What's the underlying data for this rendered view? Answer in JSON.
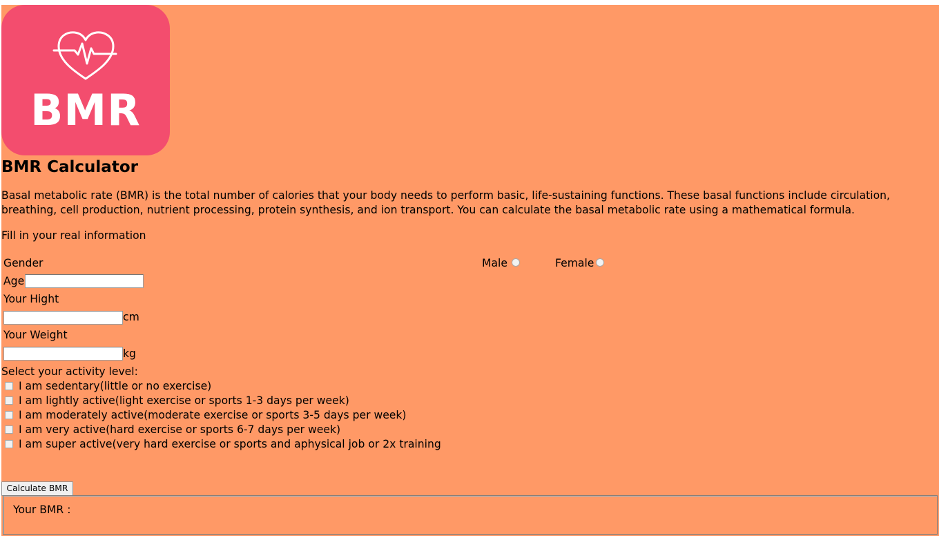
{
  "logo": {
    "text": "BMR",
    "icon": "heart-pulse-icon",
    "background_color": "#f34d6e"
  },
  "title": "BMR Calculator",
  "description": "Basal metabolic rate (BMR) is the total number of calories that your body needs to perform basic, life-sustaining functions. These basal functions include circulation, breathing, cell production, nutrient processing, protein synthesis, and ion transport. You can calculate the basal metabolic rate using a mathematical formula.",
  "form": {
    "instructions": "Fill in your real information",
    "gender": {
      "label": "Gender",
      "male": "Male",
      "female": "Female"
    },
    "age": {
      "label": "Age",
      "value": ""
    },
    "height": {
      "label": "Your Hight",
      "unit": "cm",
      "value": ""
    },
    "weight": {
      "label": "Your Weight",
      "unit": "kg",
      "value": ""
    },
    "activity": {
      "label": "Select your activity level:",
      "options": [
        "I am sedentary(little or no exercise)",
        "I am lightly active(light exercise or sports 1-3 days per week)",
        "I am moderately active(moderate exercise or sports 3-5 days per week)",
        "I am very active(hard exercise or sports 6-7 days per week)",
        "I am super active(very hard exercise or sports and aphysical job or 2x training"
      ]
    },
    "button": "Calculate BMR"
  },
  "result": {
    "label": "Your BMR :"
  },
  "colors": {
    "page_background": "#ff9966",
    "logo_background": "#f34d6e",
    "text": "#000000"
  }
}
